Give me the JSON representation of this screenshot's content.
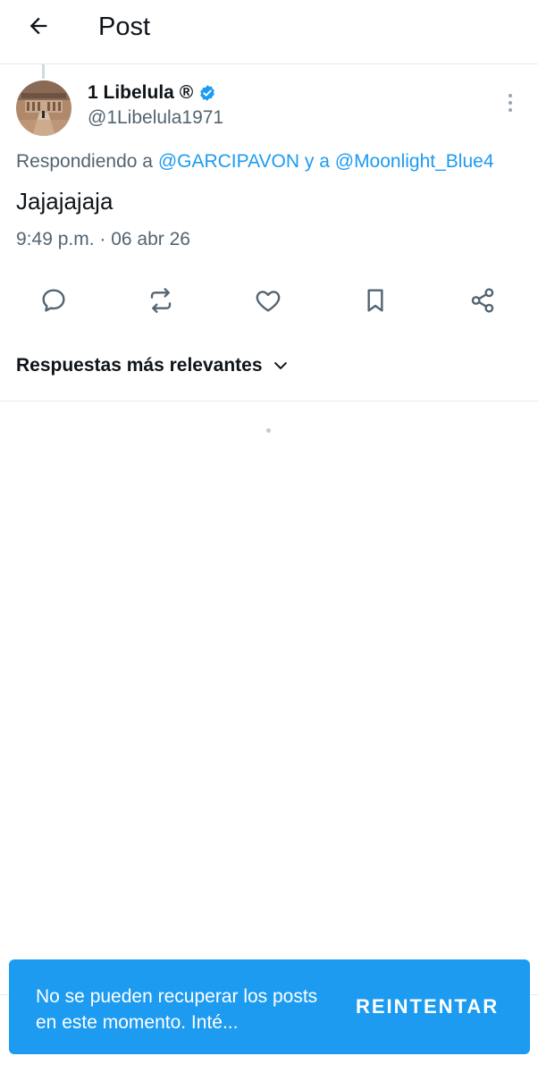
{
  "header": {
    "title": "Post",
    "back_icon": "arrow-left-icon"
  },
  "tweet": {
    "display_name": "1 Libelula ®",
    "verified_icon": "verified-badge-icon",
    "handle": "@1Libelula1971",
    "replying_prefix": "Respondiendo a",
    "replying_to": [
      "@GARCIPAVON",
      "@Moonlight_Blue4"
    ],
    "replying_joiner": "y a",
    "text": "Jajajajaja",
    "timestamp": "9:49 p.m. · 06 abr 26",
    "more_icon": "more-vertical-icon"
  },
  "actions": [
    {
      "name": "reply",
      "icon": "reply-icon"
    },
    {
      "name": "repost",
      "icon": "repost-icon"
    },
    {
      "name": "like",
      "icon": "heart-icon"
    },
    {
      "name": "bookmark",
      "icon": "bookmark-icon"
    },
    {
      "name": "share",
      "icon": "share-icon"
    }
  ],
  "replies_sort": {
    "label": "Respuestas más relevantes",
    "icon": "chevron-down-icon"
  },
  "snackbar": {
    "message": "No se pueden recuperar los posts en este momento. Inté...",
    "action": "REINTENTAR"
  },
  "colors": {
    "accent": "#1d9bf0",
    "text_primary": "#0f1419",
    "text_secondary": "#536471"
  }
}
